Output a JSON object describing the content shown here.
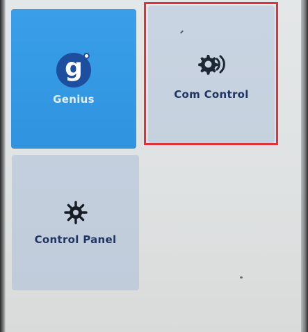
{
  "apps": [
    {
      "id": "genius",
      "label": "Genius",
      "icon": "genius-logo-icon",
      "color": "#2f93df"
    },
    {
      "id": "com_control",
      "label": "Com Control",
      "icon": "gear-broadcast-icon",
      "color": "#c9d4e2",
      "selected": true
    },
    {
      "id": "control_panel",
      "label": "Control Panel",
      "icon": "gear-icon",
      "color": "#c4cfde"
    }
  ],
  "theme": {
    "selection_outline": "#e3313a",
    "label_dark": "#1f3563",
    "background": "#e1e4e4"
  }
}
